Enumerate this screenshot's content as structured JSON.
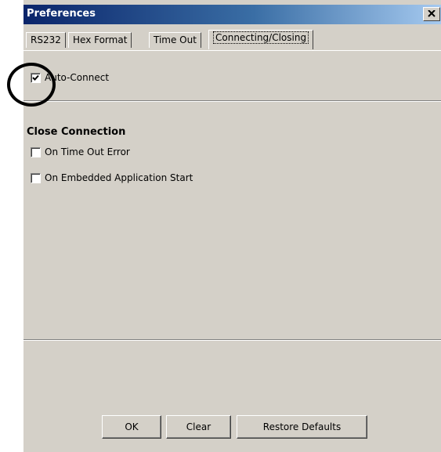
{
  "window": {
    "title": "Preferences",
    "close_icon": "close-icon"
  },
  "tabs": [
    {
      "label": "RS232"
    },
    {
      "label": "Hex Format"
    },
    {
      "label": "Time Out"
    },
    {
      "label": "Connecting/Closing",
      "active": true
    }
  ],
  "connecting": {
    "auto_connect": {
      "label": "Auto-Connect",
      "checked": true
    }
  },
  "closing": {
    "section_title": "Close Connection",
    "on_timeout_error": {
      "label": "On Time Out Error",
      "checked": false
    },
    "on_app_start": {
      "label": "On Embedded Application Start",
      "checked": false
    }
  },
  "buttons": {
    "ok": "OK",
    "clear": "Clear",
    "restore_defaults": "Restore Defaults"
  },
  "colors": {
    "title_gradient_start": "#0a246a",
    "title_gradient_end": "#a6caf0",
    "face": "#d4d0c8"
  }
}
